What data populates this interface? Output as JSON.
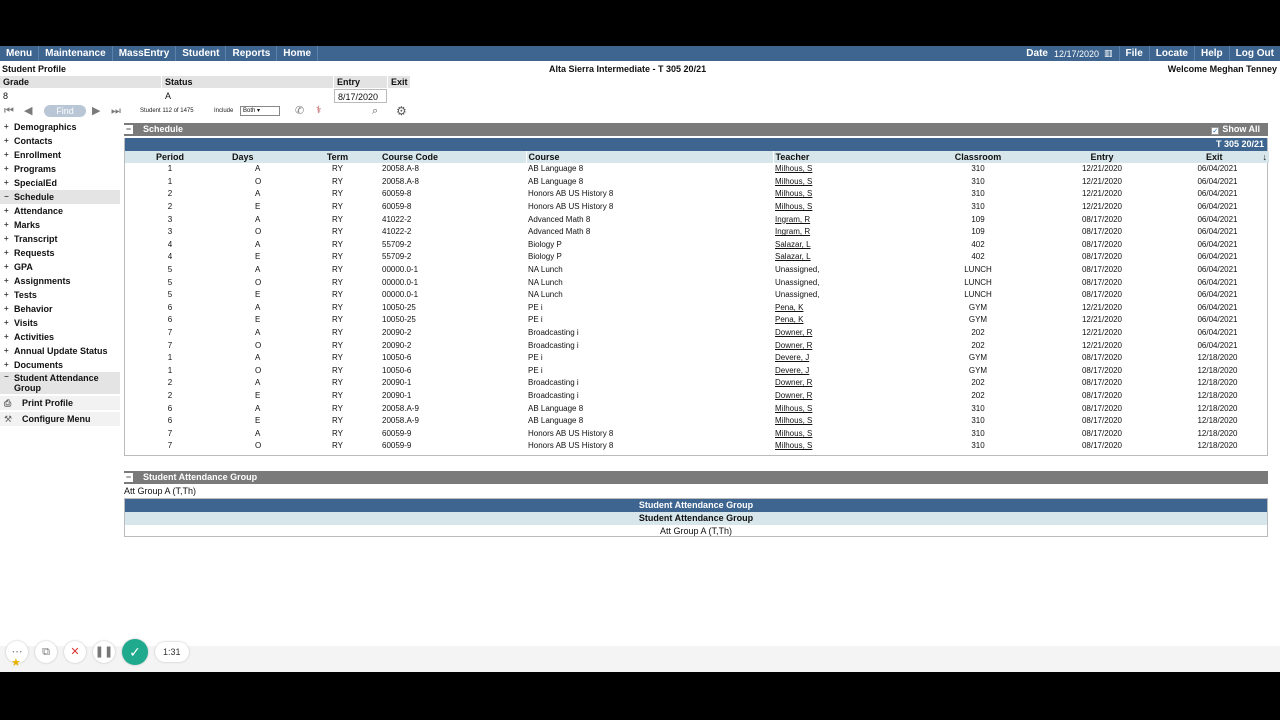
{
  "nav": {
    "left": [
      "Menu",
      "Maintenance",
      "MassEntry",
      "Student",
      "Reports",
      "Home"
    ],
    "date_label": "Date",
    "date_value": "12/17/2020",
    "right": [
      "File",
      "Locate",
      "Help",
      "Log Out"
    ]
  },
  "profile": {
    "title": "Student Profile",
    "school": "Alta Sierra Intermediate - T 305 20/21",
    "welcome": "Welcome Meghan Tenney",
    "headers": {
      "grade": "Grade",
      "status": "Status",
      "entry": "Entry",
      "exit": "Exit"
    },
    "values": {
      "grade": "8",
      "status": "A",
      "entry": "8/17/2020",
      "exit": ""
    }
  },
  "findbar": {
    "find_label": "Find",
    "student_count": "Student 112 of 1475",
    "include_label": "Include",
    "include_value": "Both"
  },
  "sidebar": {
    "items": [
      "Demographics",
      "Contacts",
      "Enrollment",
      "Programs",
      "SpecialEd",
      "Schedule",
      "Attendance",
      "Marks",
      "Transcript",
      "Requests",
      "GPA",
      "Assignments",
      "Tests",
      "Behavior",
      "Visits",
      "Activities",
      "Annual Update Status",
      "Documents"
    ],
    "active_item": "Schedule",
    "attendance_group": "Student Attendance Group",
    "print_profile": "Print Profile",
    "configure_menu": "Configure Menu"
  },
  "schedule": {
    "title": "Schedule",
    "show_all": "Show All",
    "school_code": "T 305 20/21",
    "columns": [
      "Period",
      "Days",
      "Term",
      "Course Code",
      "Course",
      "Teacher",
      "Classroom",
      "Entry",
      "Exit"
    ],
    "rows": [
      [
        "1",
        "A",
        "RY",
        "20058.A-8",
        "AB Language 8",
        "Milhous, S",
        "310",
        "12/21/2020",
        "06/04/2021"
      ],
      [
        "1",
        "O",
        "RY",
        "20058.A-8",
        "AB Language 8",
        "Milhous, S",
        "310",
        "12/21/2020",
        "06/04/2021"
      ],
      [
        "2",
        "A",
        "RY",
        "60059-8",
        "Honors AB US History 8",
        "Milhous, S",
        "310",
        "12/21/2020",
        "06/04/2021"
      ],
      [
        "2",
        "E",
        "RY",
        "60059-8",
        "Honors AB US History 8",
        "Milhous, S",
        "310",
        "12/21/2020",
        "06/04/2021"
      ],
      [
        "3",
        "A",
        "RY",
        "41022-2",
        "Advanced Math 8",
        "Ingram, R",
        "109",
        "08/17/2020",
        "06/04/2021"
      ],
      [
        "3",
        "O",
        "RY",
        "41022-2",
        "Advanced Math 8",
        "Ingram, R",
        "109",
        "08/17/2020",
        "06/04/2021"
      ],
      [
        "4",
        "A",
        "RY",
        "55709-2",
        "Biology P",
        "Salazar, L",
        "402",
        "08/17/2020",
        "06/04/2021"
      ],
      [
        "4",
        "E",
        "RY",
        "55709-2",
        "Biology P",
        "Salazar, L",
        "402",
        "08/17/2020",
        "06/04/2021"
      ],
      [
        "5",
        "A",
        "RY",
        "00000.0-1",
        "NA Lunch",
        "Unassigned,",
        "LUNCH",
        "08/17/2020",
        "06/04/2021"
      ],
      [
        "5",
        "O",
        "RY",
        "00000.0-1",
        "NA Lunch",
        "Unassigned,",
        "LUNCH",
        "08/17/2020",
        "06/04/2021"
      ],
      [
        "5",
        "E",
        "RY",
        "00000.0-1",
        "NA Lunch",
        "Unassigned,",
        "LUNCH",
        "08/17/2020",
        "06/04/2021"
      ],
      [
        "6",
        "A",
        "RY",
        "10050-25",
        "PE i",
        "Pena, K",
        "GYM",
        "12/21/2020",
        "06/04/2021"
      ],
      [
        "6",
        "E",
        "RY",
        "10050-25",
        "PE i",
        "Pena, K",
        "GYM",
        "12/21/2020",
        "06/04/2021"
      ],
      [
        "7",
        "A",
        "RY",
        "20090-2",
        "Broadcasting i",
        "Downer, R",
        "202",
        "12/21/2020",
        "06/04/2021"
      ],
      [
        "7",
        "O",
        "RY",
        "20090-2",
        "Broadcasting i",
        "Downer, R",
        "202",
        "12/21/2020",
        "06/04/2021"
      ],
      [
        "1",
        "A",
        "RY",
        "10050-6",
        "PE i",
        "Devere, J",
        "GYM",
        "08/17/2020",
        "12/18/2020"
      ],
      [
        "1",
        "O",
        "RY",
        "10050-6",
        "PE i",
        "Devere, J",
        "GYM",
        "08/17/2020",
        "12/18/2020"
      ],
      [
        "2",
        "A",
        "RY",
        "20090-1",
        "Broadcasting i",
        "Downer, R",
        "202",
        "08/17/2020",
        "12/18/2020"
      ],
      [
        "2",
        "E",
        "RY",
        "20090-1",
        "Broadcasting i",
        "Downer, R",
        "202",
        "08/17/2020",
        "12/18/2020"
      ],
      [
        "6",
        "A",
        "RY",
        "20058.A-9",
        "AB Language 8",
        "Milhous, S",
        "310",
        "08/17/2020",
        "12/18/2020"
      ],
      [
        "6",
        "E",
        "RY",
        "20058.A-9",
        "AB Language 8",
        "Milhous, S",
        "310",
        "08/17/2020",
        "12/18/2020"
      ],
      [
        "7",
        "A",
        "RY",
        "60059-9",
        "Honors AB US History 8",
        "Milhous, S",
        "310",
        "08/17/2020",
        "12/18/2020"
      ],
      [
        "7",
        "O",
        "RY",
        "60059-9",
        "Honors AB US History 8",
        "Milhous, S",
        "310",
        "08/17/2020",
        "12/18/2020"
      ]
    ]
  },
  "attendance_group": {
    "title": "Student Attendance Group",
    "label": "Att Group A (T,Th)",
    "table_title": "Student Attendance Group",
    "table_header": "Student Attendance Group",
    "table_value": "Att Group A (T,Th)"
  },
  "recorder": {
    "timer": "1:31"
  }
}
